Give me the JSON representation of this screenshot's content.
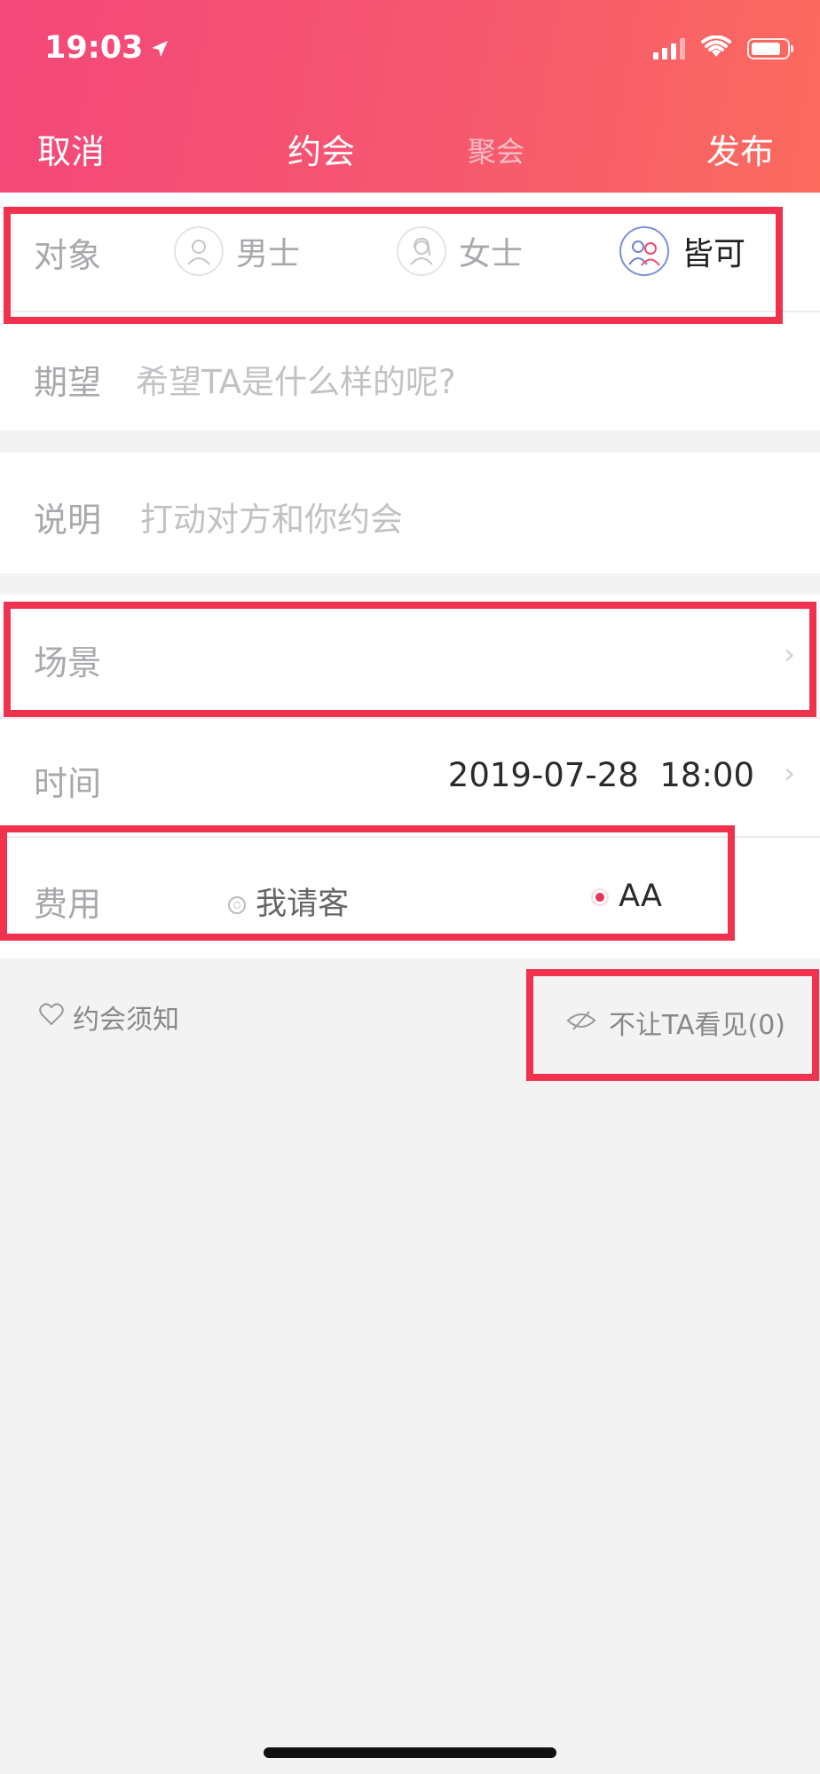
{
  "status_bar": {
    "time": "19:03"
  },
  "nav": {
    "cancel": "取消",
    "tab_date": "约会",
    "tab_party": "聚会",
    "publish": "发布"
  },
  "form": {
    "target": {
      "label": "对象",
      "options": [
        {
          "label": "男士",
          "selected": false
        },
        {
          "label": "女士",
          "selected": false
        },
        {
          "label": "皆可",
          "selected": true
        }
      ]
    },
    "expectation": {
      "label": "期望",
      "placeholder": "希望TA是什么样的呢?"
    },
    "description": {
      "label": "说明",
      "placeholder": "打动对方和你约会"
    },
    "scene": {
      "label": "场景"
    },
    "time": {
      "label": "时间",
      "date": "2019-07-28",
      "clock": "18:00"
    },
    "fee": {
      "label": "费用",
      "options": [
        {
          "label": "我请客",
          "selected": false
        },
        {
          "label": "AA",
          "selected": true
        }
      ]
    }
  },
  "footer": {
    "notice": "约会须知",
    "hide_from": "不让TA看见(0)"
  },
  "colors": {
    "accent": "#f4477a",
    "highlight_box": "#f0324f",
    "radio_on": "#e8325c"
  }
}
